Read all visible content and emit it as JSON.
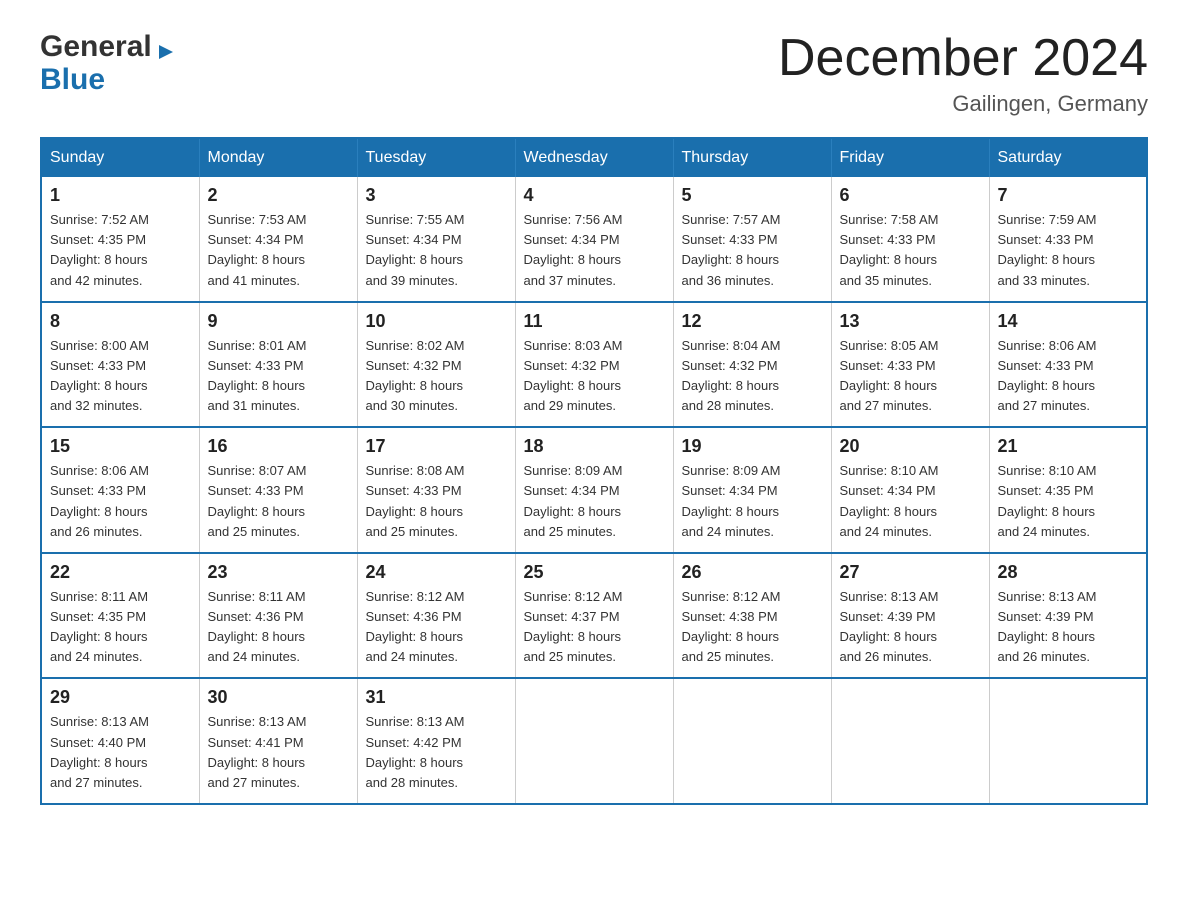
{
  "logo": {
    "general": "General",
    "blue": "Blue",
    "arrow": "▶"
  },
  "header": {
    "month_year": "December 2024",
    "location": "Gailingen, Germany"
  },
  "weekdays": [
    "Sunday",
    "Monday",
    "Tuesday",
    "Wednesday",
    "Thursday",
    "Friday",
    "Saturday"
  ],
  "weeks": [
    [
      {
        "day": "1",
        "sunrise": "7:52 AM",
        "sunset": "4:35 PM",
        "daylight": "8 hours and 42 minutes."
      },
      {
        "day": "2",
        "sunrise": "7:53 AM",
        "sunset": "4:34 PM",
        "daylight": "8 hours and 41 minutes."
      },
      {
        "day": "3",
        "sunrise": "7:55 AM",
        "sunset": "4:34 PM",
        "daylight": "8 hours and 39 minutes."
      },
      {
        "day": "4",
        "sunrise": "7:56 AM",
        "sunset": "4:34 PM",
        "daylight": "8 hours and 37 minutes."
      },
      {
        "day": "5",
        "sunrise": "7:57 AM",
        "sunset": "4:33 PM",
        "daylight": "8 hours and 36 minutes."
      },
      {
        "day": "6",
        "sunrise": "7:58 AM",
        "sunset": "4:33 PM",
        "daylight": "8 hours and 35 minutes."
      },
      {
        "day": "7",
        "sunrise": "7:59 AM",
        "sunset": "4:33 PM",
        "daylight": "8 hours and 33 minutes."
      }
    ],
    [
      {
        "day": "8",
        "sunrise": "8:00 AM",
        "sunset": "4:33 PM",
        "daylight": "8 hours and 32 minutes."
      },
      {
        "day": "9",
        "sunrise": "8:01 AM",
        "sunset": "4:33 PM",
        "daylight": "8 hours and 31 minutes."
      },
      {
        "day": "10",
        "sunrise": "8:02 AM",
        "sunset": "4:32 PM",
        "daylight": "8 hours and 30 minutes."
      },
      {
        "day": "11",
        "sunrise": "8:03 AM",
        "sunset": "4:32 PM",
        "daylight": "8 hours and 29 minutes."
      },
      {
        "day": "12",
        "sunrise": "8:04 AM",
        "sunset": "4:32 PM",
        "daylight": "8 hours and 28 minutes."
      },
      {
        "day": "13",
        "sunrise": "8:05 AM",
        "sunset": "4:33 PM",
        "daylight": "8 hours and 27 minutes."
      },
      {
        "day": "14",
        "sunrise": "8:06 AM",
        "sunset": "4:33 PM",
        "daylight": "8 hours and 27 minutes."
      }
    ],
    [
      {
        "day": "15",
        "sunrise": "8:06 AM",
        "sunset": "4:33 PM",
        "daylight": "8 hours and 26 minutes."
      },
      {
        "day": "16",
        "sunrise": "8:07 AM",
        "sunset": "4:33 PM",
        "daylight": "8 hours and 25 minutes."
      },
      {
        "day": "17",
        "sunrise": "8:08 AM",
        "sunset": "4:33 PM",
        "daylight": "8 hours and 25 minutes."
      },
      {
        "day": "18",
        "sunrise": "8:09 AM",
        "sunset": "4:34 PM",
        "daylight": "8 hours and 25 minutes."
      },
      {
        "day": "19",
        "sunrise": "8:09 AM",
        "sunset": "4:34 PM",
        "daylight": "8 hours and 24 minutes."
      },
      {
        "day": "20",
        "sunrise": "8:10 AM",
        "sunset": "4:34 PM",
        "daylight": "8 hours and 24 minutes."
      },
      {
        "day": "21",
        "sunrise": "8:10 AM",
        "sunset": "4:35 PM",
        "daylight": "8 hours and 24 minutes."
      }
    ],
    [
      {
        "day": "22",
        "sunrise": "8:11 AM",
        "sunset": "4:35 PM",
        "daylight": "8 hours and 24 minutes."
      },
      {
        "day": "23",
        "sunrise": "8:11 AM",
        "sunset": "4:36 PM",
        "daylight": "8 hours and 24 minutes."
      },
      {
        "day": "24",
        "sunrise": "8:12 AM",
        "sunset": "4:36 PM",
        "daylight": "8 hours and 24 minutes."
      },
      {
        "day": "25",
        "sunrise": "8:12 AM",
        "sunset": "4:37 PM",
        "daylight": "8 hours and 25 minutes."
      },
      {
        "day": "26",
        "sunrise": "8:12 AM",
        "sunset": "4:38 PM",
        "daylight": "8 hours and 25 minutes."
      },
      {
        "day": "27",
        "sunrise": "8:13 AM",
        "sunset": "4:39 PM",
        "daylight": "8 hours and 26 minutes."
      },
      {
        "day": "28",
        "sunrise": "8:13 AM",
        "sunset": "4:39 PM",
        "daylight": "8 hours and 26 minutes."
      }
    ],
    [
      {
        "day": "29",
        "sunrise": "8:13 AM",
        "sunset": "4:40 PM",
        "daylight": "8 hours and 27 minutes."
      },
      {
        "day": "30",
        "sunrise": "8:13 AM",
        "sunset": "4:41 PM",
        "daylight": "8 hours and 27 minutes."
      },
      {
        "day": "31",
        "sunrise": "8:13 AM",
        "sunset": "4:42 PM",
        "daylight": "8 hours and 28 minutes."
      },
      null,
      null,
      null,
      null
    ]
  ],
  "labels": {
    "sunrise": "Sunrise:",
    "sunset": "Sunset:",
    "daylight": "Daylight:"
  }
}
